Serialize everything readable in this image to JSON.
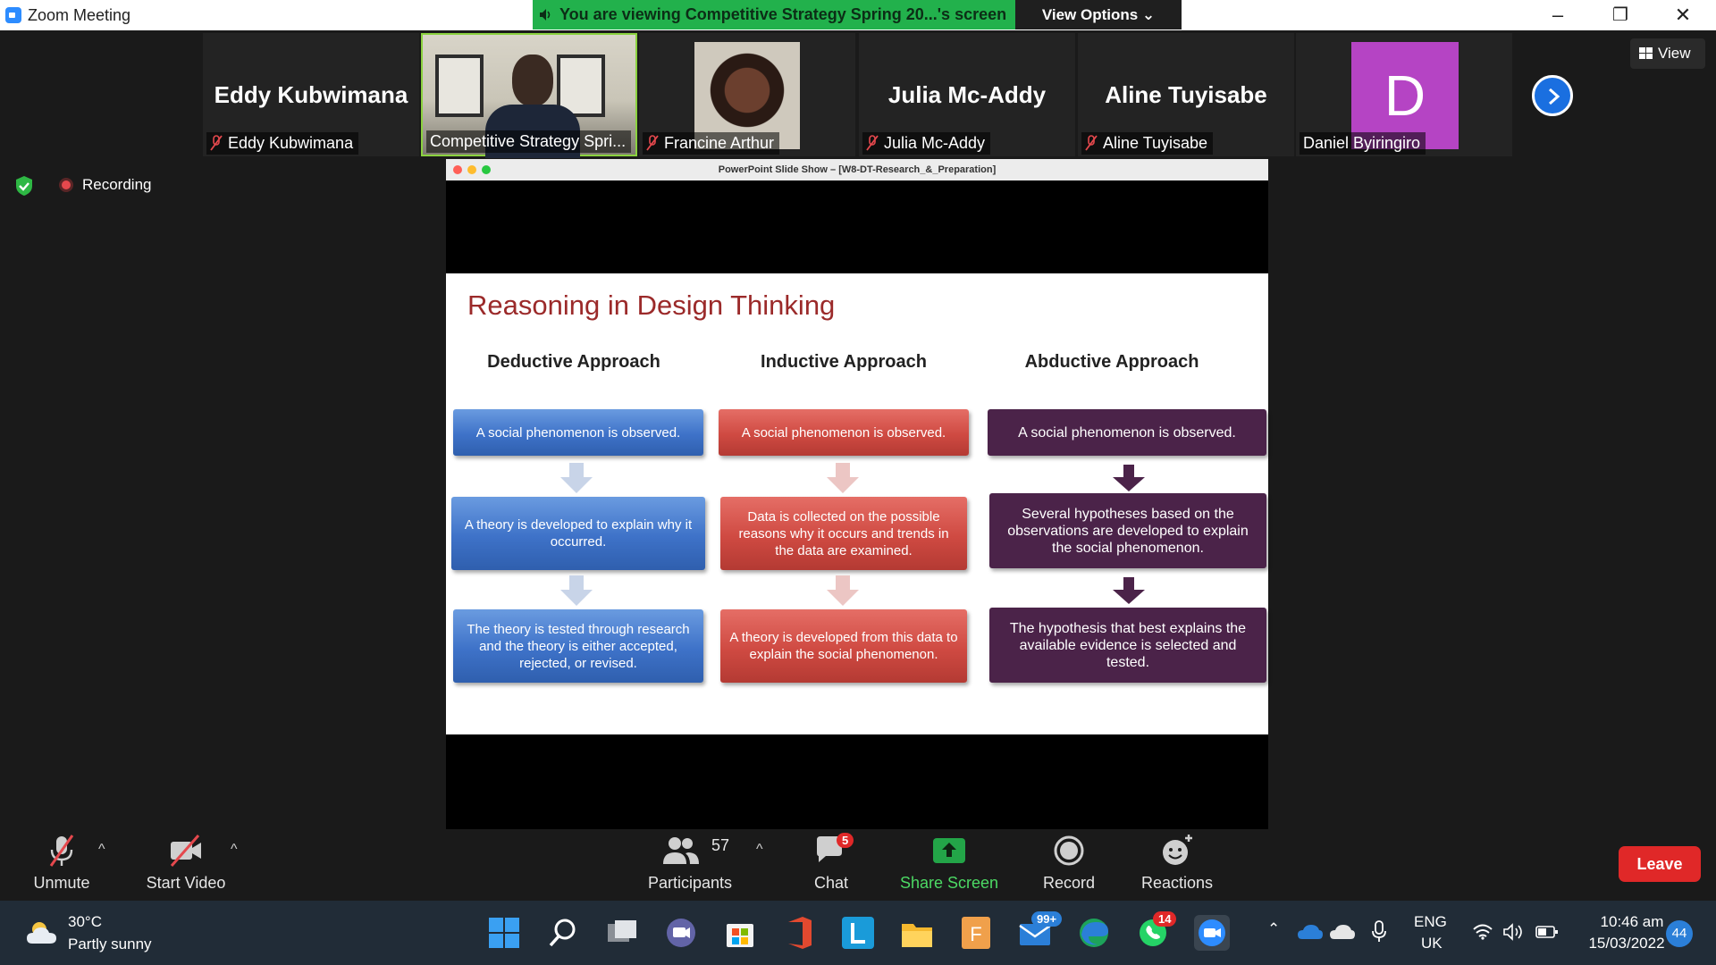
{
  "window": {
    "title": "Zoom Meeting"
  },
  "share_banner": {
    "text": "You are viewing Competitive Strategy Spring 20...'s screen",
    "view_options": "View Options ⌄"
  },
  "window_controls": {
    "minimize": "–",
    "restore": "❐",
    "close": "✕"
  },
  "participants_strip": [
    {
      "display": "Eddy Kubwimana",
      "label": "Eddy Kubwimana",
      "muted": true
    },
    {
      "display": "",
      "label": "Competitive Strategy Spri...",
      "muted": false,
      "active": true
    },
    {
      "display": "",
      "label": "Francine Arthur",
      "muted": true
    },
    {
      "display": "Julia Mc-Addy",
      "label": "Julia Mc-Addy",
      "muted": true
    },
    {
      "display": "Aline Tuyisabe",
      "label": "Aline Tuyisabe",
      "muted": true
    },
    {
      "display": "D",
      "label": "Daniel Byiringiro",
      "muted": false
    }
  ],
  "view_button": "View",
  "recording": "Recording",
  "presentation": {
    "window_title": "PowerPoint Slide Show – [W8-DT-Research_&_Preparation]",
    "slide_title": "Reasoning in Design Thinking",
    "columns": [
      {
        "heading": "Deductive Approach",
        "color": "#3e72c8",
        "steps": [
          "A social phenomenon is observed.",
          "A theory is developed to explain why it occurred.",
          "The theory is tested through research and the theory is either accepted, rejected, or revised."
        ]
      },
      {
        "heading": "Inductive Approach",
        "color": "#cf4a42",
        "steps": [
          "A social phenomenon is observed.",
          "Data is collected on the possible reasons why it occurs and trends in the data are examined.",
          "A theory is developed from this data to explain the social phenomenon."
        ]
      },
      {
        "heading": "Abductive Approach",
        "color": "#4b2349",
        "steps": [
          "A social phenomenon is observed.",
          "Several hypotheses based on the observations are developed to explain the social phenomenon.",
          "The hypothesis that best explains the available evidence is selected and tested."
        ]
      }
    ]
  },
  "toolbar": {
    "unmute": "Unmute",
    "start_video": "Start Video",
    "participants": "Participants",
    "participants_count": "57",
    "chat": "Chat",
    "chat_badge": "5",
    "share_screen": "Share Screen",
    "record": "Record",
    "reactions": "Reactions",
    "leave": "Leave",
    "caret": "^"
  },
  "taskbar": {
    "weather_temp": "30°C",
    "weather_desc": "Partly sunny",
    "mail_badge": "99+",
    "whatsapp_badge": "14",
    "lang_top": "ENG",
    "lang_bottom": "UK",
    "time": "10:46 am",
    "date": "15/03/2022",
    "notifications": "44"
  },
  "colors": {
    "accent_green": "#22b14c",
    "leave_red": "#e02828",
    "zoom_blue": "#2d8cff"
  }
}
